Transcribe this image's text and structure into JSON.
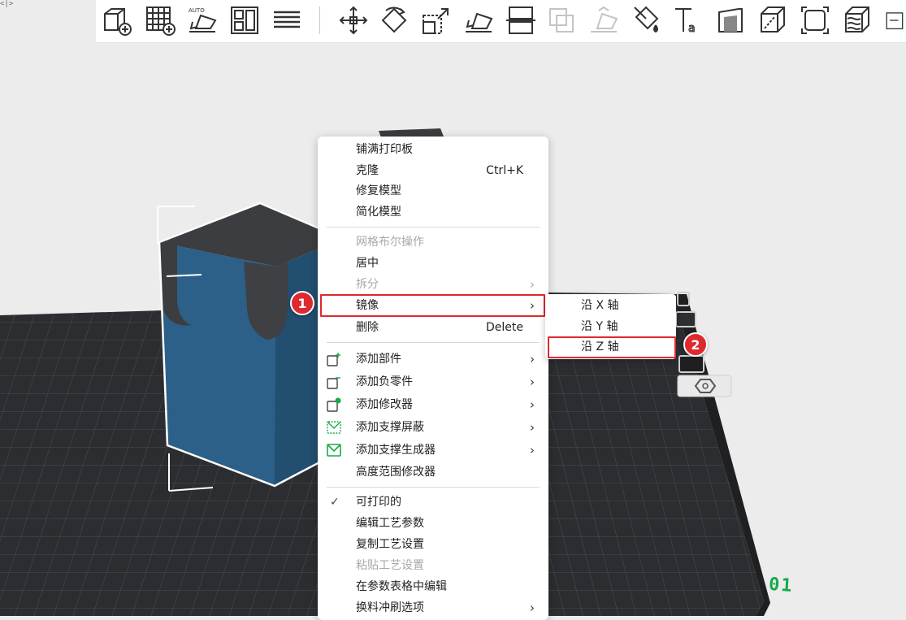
{
  "app": {
    "corner_glyph": "<|>"
  },
  "toolbar": {
    "buttons": [
      {
        "icon": "add-cube-icon"
      },
      {
        "icon": "add-plate-icon"
      },
      {
        "icon": "auto-orient-icon",
        "text": "AUTO"
      },
      {
        "icon": "arrange-icon"
      },
      {
        "icon": "layers-list-icon"
      },
      {
        "icon": "move-icon"
      },
      {
        "icon": "rotate-icon"
      },
      {
        "icon": "scale-icon"
      },
      {
        "icon": "lay-on-face-icon"
      },
      {
        "icon": "cut-icon"
      },
      {
        "icon": "boolean-icon"
      },
      {
        "icon": "lay-on-face-disabled-icon"
      },
      {
        "icon": "paint-bucket-icon"
      },
      {
        "icon": "text-tool-icon"
      },
      {
        "icon": "measure-icon"
      },
      {
        "icon": "assembly-cube-icon"
      },
      {
        "icon": "fillet-icon"
      },
      {
        "icon": "variable-layer-icon"
      }
    ]
  },
  "context_menu": {
    "items": [
      {
        "label": "铺满打印板"
      },
      {
        "label": "克隆",
        "shortcut": "Ctrl+K"
      },
      {
        "label": "修复模型"
      },
      {
        "label": "简化模型"
      },
      {
        "label": "网格布尔操作",
        "disabled": true
      },
      {
        "label": "居中"
      },
      {
        "label": "拆分",
        "disabled": true,
        "submenu": true
      },
      {
        "label": "镜像",
        "submenu": true,
        "highlighted": true
      },
      {
        "label": "删除",
        "shortcut": "Delete"
      },
      {
        "label": "添加部件",
        "submenu": true,
        "icon": "add-part-icon"
      },
      {
        "label": "添加负零件",
        "submenu": true,
        "icon": "add-negative-part-icon"
      },
      {
        "label": "添加修改器",
        "submenu": true,
        "icon": "add-modifier-icon"
      },
      {
        "label": "添加支撑屏蔽",
        "submenu": true,
        "icon": "support-blocker-icon"
      },
      {
        "label": "添加支撑生成器",
        "submenu": true,
        "icon": "support-enforcer-icon"
      },
      {
        "label": "高度范围修改器"
      },
      {
        "label": "可打印的",
        "checked": true
      },
      {
        "label": "编辑工艺参数"
      },
      {
        "label": "复制工艺设置"
      },
      {
        "label": "粘贴工艺设置",
        "disabled": true
      },
      {
        "label": "在参数表格中编辑"
      },
      {
        "label": "换料冲刷选项",
        "submenu": true
      }
    ],
    "submenu_arrow": "›",
    "check_mark": "✓"
  },
  "mirror_submenu": {
    "items": [
      {
        "label": "沿 X 轴"
      },
      {
        "label": "沿 Y 轴"
      },
      {
        "label": "沿 Z 轴",
        "highlighted": true
      }
    ]
  },
  "annotations": {
    "step1": "1",
    "step2": "2"
  },
  "plate": {
    "number": "01"
  },
  "colors": {
    "highlight_red": "#e0282e",
    "badge_red": "#dd2a30",
    "model_blue": "#2b5f86",
    "model_top": "#3b3d40",
    "bed_dark": "#2a2c2f",
    "bed_grid": "#4a4d52",
    "plate_green": "#1aa84a",
    "modifier_green": "#1aa84a",
    "support_green": "#1aa84a"
  }
}
